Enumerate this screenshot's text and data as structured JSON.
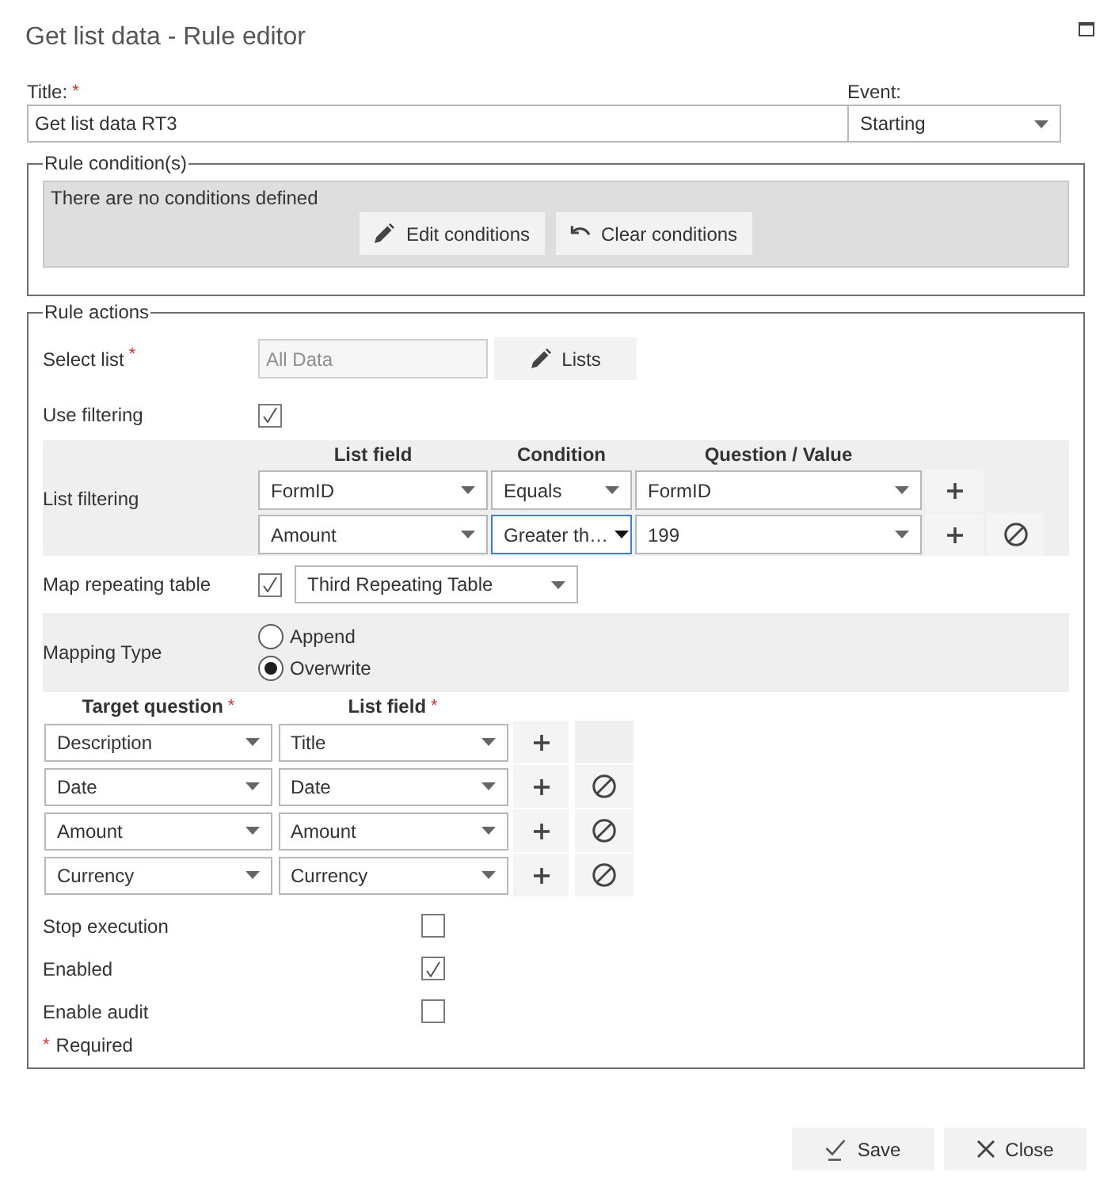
{
  "window": {
    "title": "Get list data - Rule editor"
  },
  "title_field": {
    "label": "Title:",
    "required_mark": "*",
    "value": "Get list data RT3"
  },
  "event_field": {
    "label": "Event:",
    "value": "Starting"
  },
  "rule_conditions": {
    "legend": "Rule condition(s)",
    "message": "There are no conditions defined",
    "buttons": [
      {
        "kind": "edit",
        "label": "Edit conditions"
      },
      {
        "kind": "clear",
        "label": "Clear conditions"
      }
    ]
  },
  "rule_actions": {
    "legend": "Rule actions",
    "select_list": {
      "label": "Select list",
      "required_mark": "*",
      "value": "All Data",
      "disabled": true,
      "button": {
        "kind": "edit",
        "label": "Lists"
      }
    },
    "use_filtering": {
      "label": "Use filtering",
      "checked": true
    },
    "list_filtering": {
      "label": "List filtering",
      "columns": [
        "List field",
        "Condition",
        "Question / Value"
      ],
      "rows": [
        {
          "list_field": "FormID",
          "condition": "Equals",
          "condition_focused": false,
          "value": "FormID",
          "actions": [
            {
              "kind": "add"
            }
          ]
        },
        {
          "list_field": "Amount",
          "condition": "Greater th…",
          "condition_focused": true,
          "value": "199",
          "actions": [
            {
              "kind": "add"
            },
            {
              "kind": "remove"
            }
          ]
        }
      ]
    },
    "map_repeating_table": {
      "label": "Map repeating table",
      "checked": true,
      "table": "Third Repeating Table"
    },
    "mapping_type": {
      "label": "Mapping Type",
      "options": [
        {
          "label": "Append",
          "selected": false
        },
        {
          "label": "Overwrite",
          "selected": true
        }
      ]
    },
    "mapping": {
      "columns": [
        {
          "label": "Target question",
          "required_mark": "*"
        },
        {
          "label": "List field",
          "required_mark": "*"
        }
      ],
      "rows": [
        {
          "target_question": "Description",
          "list_field": "Title",
          "removable": false
        },
        {
          "target_question": "Date",
          "list_field": "Date",
          "removable": true
        },
        {
          "target_question": "Amount",
          "list_field": "Amount",
          "removable": true
        },
        {
          "target_question": "Currency",
          "list_field": "Currency",
          "removable": true
        }
      ]
    },
    "options": [
      {
        "label": "Stop execution",
        "checked": false
      },
      {
        "label": "Enabled",
        "checked": true
      },
      {
        "label": "Enable audit",
        "checked": false
      }
    ],
    "required_note": {
      "mark": "*",
      "text": "Required"
    }
  },
  "footer_buttons": [
    {
      "kind": "save",
      "label": "Save"
    },
    {
      "kind": "close",
      "label": "Close"
    }
  ]
}
